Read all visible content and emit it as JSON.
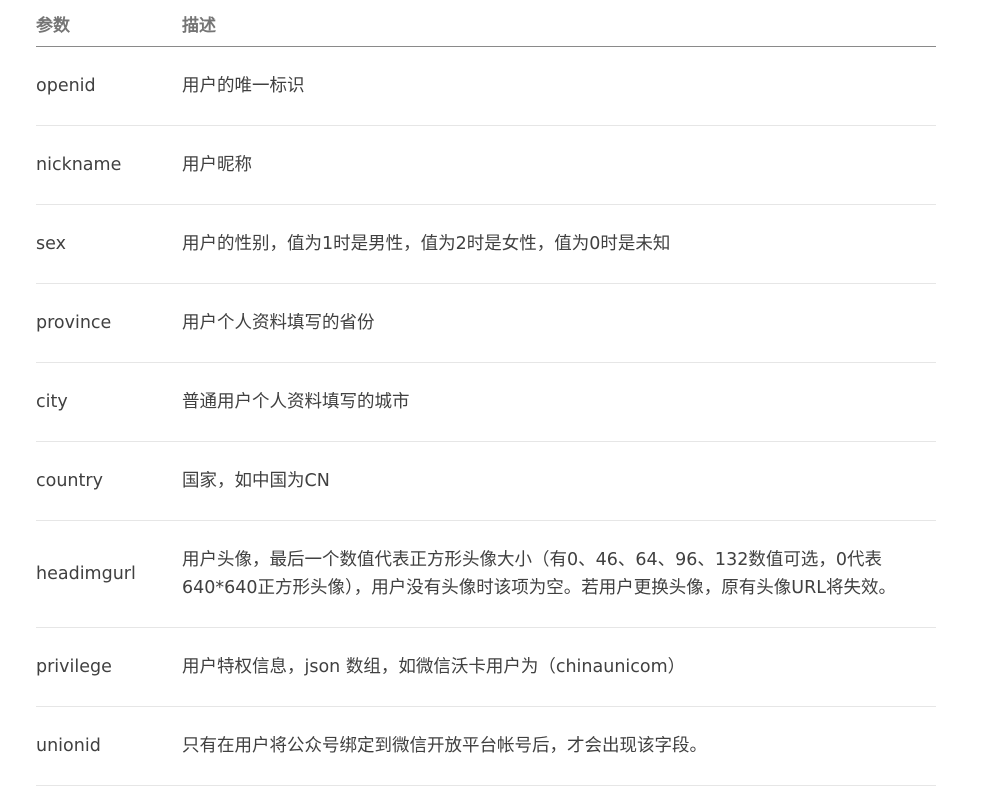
{
  "table": {
    "headers": {
      "param": "参数",
      "desc": "描述"
    },
    "rows": [
      {
        "param": "openid",
        "desc": "用户的唯一标识"
      },
      {
        "param": "nickname",
        "desc": "用户昵称"
      },
      {
        "param": "sex",
        "desc": "用户的性别，值为1时是男性，值为2时是女性，值为0时是未知"
      },
      {
        "param": "province",
        "desc": "用户个人资料填写的省份"
      },
      {
        "param": "city",
        "desc": "普通用户个人资料填写的城市"
      },
      {
        "param": "country",
        "desc": "国家，如中国为CN"
      },
      {
        "param": "headimgurl",
        "desc": "用户头像，最后一个数值代表正方形头像大小（有0、46、64、96、132数值可选，0代表640*640正方形头像），用户没有头像时该项为空。若用户更换头像，原有头像URL将失效。"
      },
      {
        "param": "privilege",
        "desc": "用户特权信息，json 数组，如微信沃卡用户为（chinaunicom）"
      },
      {
        "param": "unionid",
        "desc": "只有在用户将公众号绑定到微信开放平台帐号后，才会出现该字段。"
      }
    ]
  }
}
